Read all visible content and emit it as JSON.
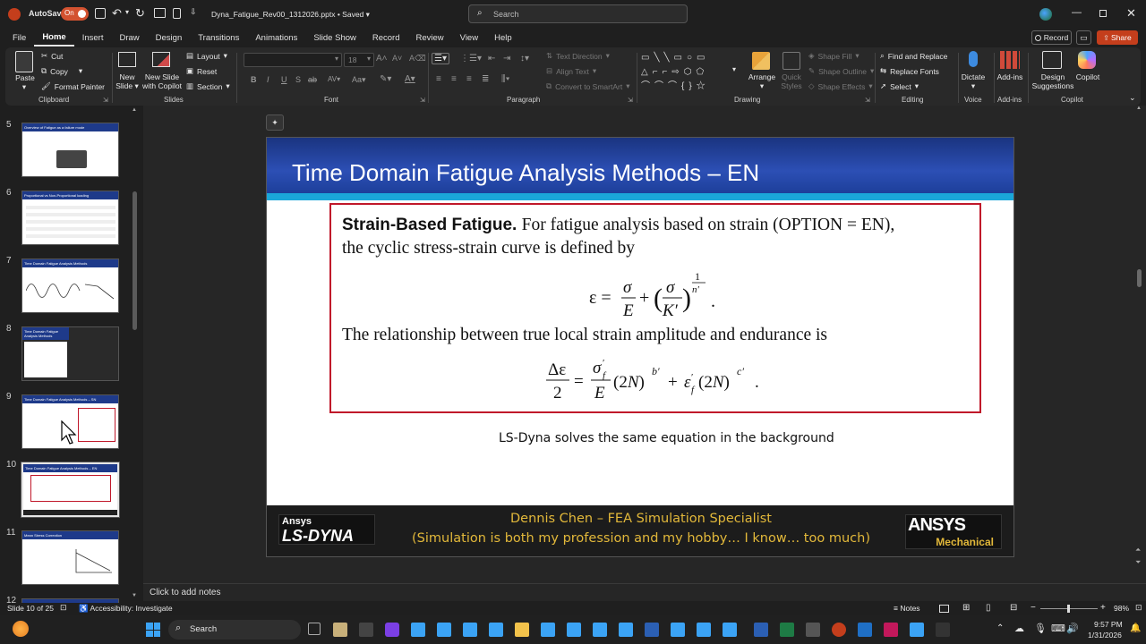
{
  "window": {
    "autosave_label": "AutoSave",
    "autosave_state": "On",
    "filename": "Dyna_Fatigue_Rev00_1312026.pptx",
    "saved_state": "Saved",
    "search_placeholder": "Search"
  },
  "menu": {
    "tabs": [
      "File",
      "Home",
      "Insert",
      "Draw",
      "Design",
      "Transitions",
      "Animations",
      "Slide Show",
      "Record",
      "Review",
      "View",
      "Help"
    ],
    "record_button": "Record",
    "share_button": "Share"
  },
  "ribbon": {
    "paste": "Paste",
    "cut": "Cut",
    "copy": "Copy",
    "format_painter": "Format Painter",
    "clipboard_label": "Clipboard",
    "new_slide": "New Slide",
    "new_slide_copilot": "New Slide with Copilot",
    "layout": "Layout",
    "reset": "Reset",
    "section": "Section",
    "slides_label": "Slides",
    "font_size": "18",
    "font_label": "Font",
    "paragraph_label": "Paragraph",
    "text_direction": "Text Direction",
    "align_text": "Align Text",
    "convert_smartart": "Convert to SmartArt",
    "arrange": "Arrange",
    "quick_styles": "Quick Styles",
    "shape_fill": "Shape Fill",
    "shape_outline": "Shape Outline",
    "shape_effects": "Shape Effects",
    "drawing_label": "Drawing",
    "find_replace": "Find and Replace",
    "replace_fonts": "Replace Fonts",
    "select": "Select",
    "editing_label": "Editing",
    "dictate": "Dictate",
    "voice_label": "Voice",
    "addins": "Add-ins",
    "addins_label": "Add-ins",
    "design_suggestions": "Design Suggestions",
    "copilot": "Copilot",
    "copilot_label": "Copilot"
  },
  "thumbnails": [
    {
      "num": "5",
      "title": "Overview of Fatigue as a failure mode"
    },
    {
      "num": "6",
      "title": "Proportional vs Non-Proportional loading"
    },
    {
      "num": "7",
      "title": "Time Domain Fatigue Analysis Methods"
    },
    {
      "num": "8",
      "title": "Time Domain Fatigue Analysis Methods"
    },
    {
      "num": "9",
      "title": "Time Domain Fatigue Analysis Methods – SN"
    },
    {
      "num": "10",
      "title": "Time Domain Fatigue Analysis Methods – EN"
    },
    {
      "num": "11",
      "title": "Mean Stress Correction"
    },
    {
      "num": "12",
      "title": ""
    }
  ],
  "slide": {
    "title": "Time Domain Fatigue Analysis Methods – EN",
    "para1_bold": "Strain-Based Fatigue.",
    "para1_rest": "For fatigue analysis based on strain (OPTION = EN),",
    "para1_line2": "the cyclic stress-strain curve is defined by",
    "para2": "The relationship between true local strain amplitude and endurance is",
    "caption": "LS-Dyna solves the same equation in the background",
    "footer_line1": "Dennis Chen – FEA Simulation Specialist",
    "footer_line2": "(Simulation is both my profession and my hobby… I know… too much)",
    "logo_left_top": "Ansys",
    "logo_left_bottom": "LS-DYNA",
    "logo_right_top": "ANSYS",
    "logo_right_bottom": "Mechanical"
  },
  "notes": {
    "placeholder": "Click to add notes"
  },
  "status": {
    "slide_info": "Slide 10 of 25",
    "accessibility": "Accessibility: Investigate",
    "notes_button": "Notes",
    "zoom": "98%"
  },
  "taskbar": {
    "search": "Search",
    "time": "9:57 PM",
    "date": "1/31/2026"
  },
  "colors": {
    "accent_red": "#c0182a",
    "slide_blue": "#1e3a8a",
    "footer_gold": "#e2b83a",
    "autosave_orange": "#d35230"
  }
}
